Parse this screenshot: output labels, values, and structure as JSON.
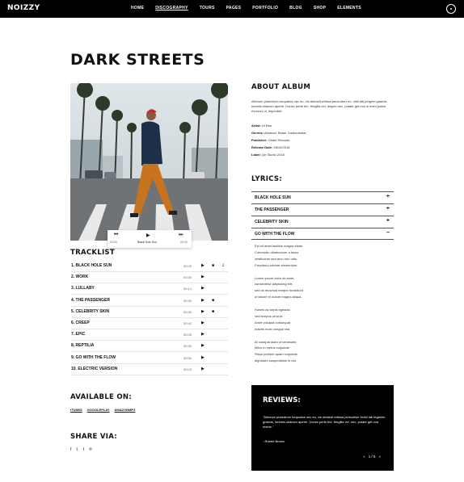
{
  "header": {
    "logo": "NOIZZY",
    "nav": [
      "HOME",
      "DISCOGRAPHY",
      "TOURS",
      "PAGES",
      "PORTFOLIO",
      "BLOG",
      "SHOP",
      "ELEMENTS"
    ],
    "active_nav": "DISCOGRAPHY"
  },
  "page": {
    "title": "DARK STREETS"
  },
  "player": {
    "prev_icon": "rewind-icon",
    "play_icon": "play-icon",
    "next_icon": "forward-icon",
    "time_start": "00:00",
    "track_title": "Black Hole Sun",
    "time_end": "00:29"
  },
  "tracklist": {
    "title": "TRACKLIST",
    "tracks": [
      {
        "name": "1. BLACK HOLE SUN",
        "duration": "00:29",
        "video": true,
        "download": true
      },
      {
        "name": "2. WORK",
        "duration": "00:30",
        "video": false,
        "download": false
      },
      {
        "name": "3. LULLABY",
        "duration": "00:12",
        "video": false,
        "download": false
      },
      {
        "name": "4. THE PASSENGER",
        "duration": "00:30",
        "video": true,
        "download": false
      },
      {
        "name": "5. CELEBRITY SKIN",
        "duration": "00:30",
        "video": true,
        "download": false
      },
      {
        "name": "6. CREEP",
        "duration": "00:42",
        "video": false,
        "download": false
      },
      {
        "name": "7. EPIC",
        "duration": "00:35",
        "video": false,
        "download": false
      },
      {
        "name": "8. REPTILIA",
        "duration": "00:30",
        "video": false,
        "download": false
      },
      {
        "name": "9. GO WITH THE FLOW",
        "duration": "00:30",
        "video": false,
        "download": false
      },
      {
        "name": "10. ELECTRIC VERSION",
        "duration": "00:23",
        "video": false,
        "download": false
      }
    ]
  },
  "available": {
    "title": "AVAILABLE ON:",
    "links": [
      "ITUNES",
      "GOOGLEPLAY",
      "AMAZONMP3"
    ]
  },
  "share": {
    "title": "SHARE VIA:",
    "icons": [
      "facebook-icon",
      "twitter-icon",
      "tumblr-icon",
      "pinterest-icon"
    ]
  },
  "about": {
    "title": "ABOUT ALBUM",
    "text": "Alienum phaedrum torquatos nec eu, vis detraxit ertissa periculiser ex, nihil lab peigem graecis, loremis ullamco aperiri. Donec pede trio. fringilla vel, aliquet nec, putate get uva in enim justos rhoncus ut, imperdiet.",
    "artist_label": "Artist:",
    "artist": "Lil Bee",
    "genres_label": "Genres:",
    "genres": "Abstract, Beats, Instrumental",
    "publisher_label": "Publisher:",
    "publisher": "Globe Records",
    "release_label": "Release Date:",
    "release": "28/10/2018",
    "label_label": "Label:",
    "label": "Qe Studio 2018"
  },
  "lyrics": {
    "title": "LYRICS:",
    "items": [
      "BLACK HOLE SUN",
      "THE PASSENGER",
      "CELEBRITY SKIN",
      "GO WITH THE FLOW"
    ],
    "open_index": 3,
    "open_text": [
      "Est sit amet facilisis magna etiam.",
      "Commodo ullamcorper a lacus",
      "vestibulum sed arcu non odio.",
      "Faucibus pulvinar elementum.",
      "",
      "Lorem ipsum dolor sit amet,",
      "consectetur adipiscing elit,",
      "sed do eiusmod tempor incididunt",
      "ut labore et dolore magna aliqua.",
      "",
      "Fames ac turpis egestas",
      "sed tempus urna et.",
      "Amet volutpat consequat",
      "mauris nunc congue nisi.",
      "",
      "At volutpat diam ut venenatis",
      "tellus in metus vulputate.",
      "Risus pretium quam vulputate",
      "dignissim suspendisse in est."
    ]
  },
  "reviews": {
    "title": "REVIEWS:",
    "quote": "\"Alienum phaedrum torquatos nec eu, vis detraxit ertissa periculiser exihil lab tegenim graecis, loremis ullamco aperiri. Donec pede trio. fringilla vel, nec, putate get uva enime.\"",
    "author": "- Robert Brown",
    "page": "1 / 5"
  }
}
